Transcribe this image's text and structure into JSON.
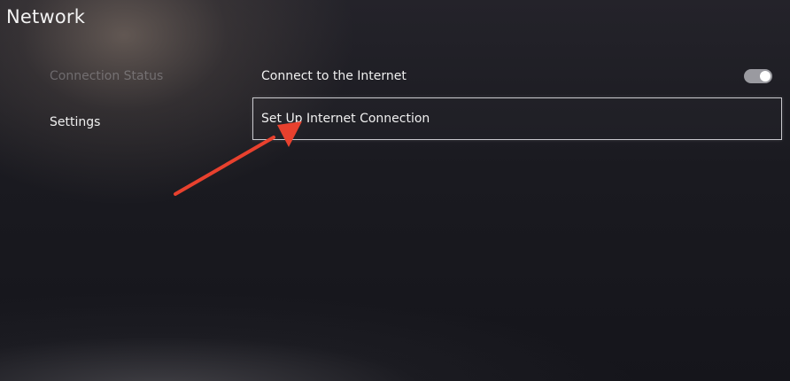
{
  "header": {
    "title": "Network"
  },
  "sidebar": {
    "items": [
      {
        "label": "Connection Status",
        "state": "disabled"
      },
      {
        "label": "Settings",
        "state": "selected"
      }
    ]
  },
  "settings": {
    "connect_internet": {
      "label": "Connect to the Internet",
      "toggle_on": true
    },
    "setup_connection": {
      "label": "Set Up Internet Connection",
      "focused": true
    }
  },
  "colors": {
    "annotation_arrow": "#e8412e",
    "toggle_track": "#9a9aa0",
    "focus_border": "#e6e6eb"
  },
  "icons": {
    "annotation": "red-arrow-icon"
  }
}
